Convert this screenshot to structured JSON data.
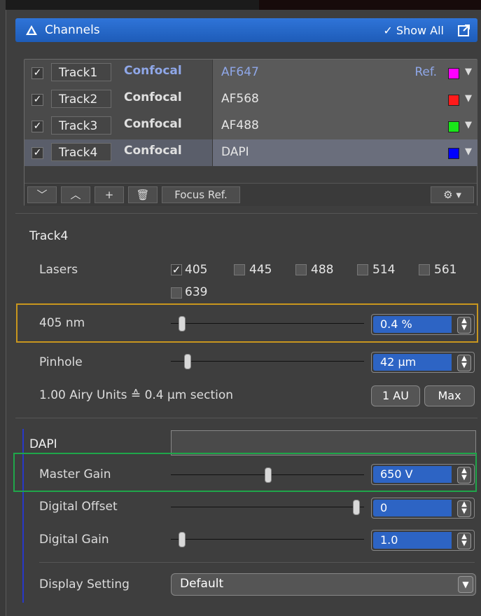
{
  "header": {
    "title": "Channels",
    "show_all": "Show All"
  },
  "tracks": [
    {
      "checked": true,
      "name": "Track1",
      "mode": "Confocal",
      "channel": "AF647",
      "ref": "Ref.",
      "color": "#ff00ff"
    },
    {
      "checked": true,
      "name": "Track2",
      "mode": "Confocal",
      "channel": "AF568",
      "ref": "",
      "color": "#ff1a1a"
    },
    {
      "checked": true,
      "name": "Track3",
      "mode": "Confocal",
      "channel": "AF488",
      "ref": "",
      "color": "#19e619"
    },
    {
      "checked": true,
      "name": "Track4",
      "mode": "Confocal",
      "channel": "DAPI",
      "ref": "",
      "color": "#0000ff"
    }
  ],
  "toolbar": {
    "focus_ref": "Focus Ref."
  },
  "track_settings": {
    "title": "Track4",
    "lasers_label": "Lasers",
    "lasers": [
      {
        "nm": "405",
        "checked": true
      },
      {
        "nm": "445",
        "checked": false
      },
      {
        "nm": "488",
        "checked": false
      },
      {
        "nm": "514",
        "checked": false
      },
      {
        "nm": "561",
        "checked": false
      },
      {
        "nm": "639",
        "checked": false
      }
    ],
    "laser_power": {
      "label": "405 nm",
      "value": "0.4 %",
      "level": 0.04
    },
    "pinhole": {
      "label": "Pinhole",
      "value": "42 µm",
      "level": 0.07
    },
    "airy": "1.00 Airy Units ≙ 0.4 µm section",
    "au_button": "1 AU",
    "max_button": "Max"
  },
  "channel_settings": {
    "title": "DAPI",
    "master_gain": {
      "label": "Master Gain",
      "value": "650 V",
      "level": 0.5
    },
    "digital_offset": {
      "label": "Digital Offset",
      "value": "0",
      "level": 0.97
    },
    "digital_gain": {
      "label": "Digital Gain",
      "value": "1.0",
      "level": 0.04
    },
    "display_setting": {
      "label": "Display Setting",
      "value": "Default"
    }
  },
  "colors": {
    "accent": "#2d64c4",
    "laser_highlight": "#c8961e",
    "gain_highlight": "#1fa64a"
  }
}
